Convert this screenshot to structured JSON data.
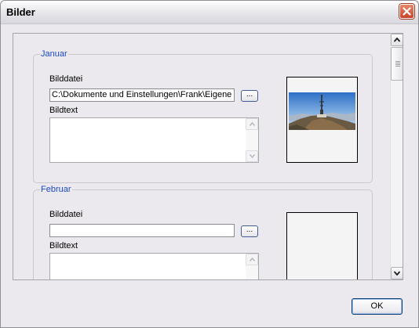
{
  "window": {
    "title": "Bilder"
  },
  "groups": [
    {
      "legend": "Januar",
      "file_label": "Bilddatei",
      "file_value": "C:\\Dokumente und Einstellungen\\Frank\\Eigene",
      "browse_label": "...",
      "text_label": "Bildtext",
      "text_value": "",
      "has_image": true
    },
    {
      "legend": "Februar",
      "file_label": "Bilddatei",
      "file_value": "",
      "browse_label": "...",
      "text_label": "Bildtext",
      "text_value": "",
      "has_image": false
    }
  ],
  "footer": {
    "ok_label": "OK"
  },
  "icons": {
    "close": "close-x-icon",
    "scroll_up": "arrow-up-icon",
    "scroll_down": "arrow-down-icon",
    "photo": "mountain-antenna-photo"
  },
  "colors": {
    "legend_text": "#1a49c9",
    "close_button": "#c9452b",
    "window_bg": "#ebe9ed"
  }
}
